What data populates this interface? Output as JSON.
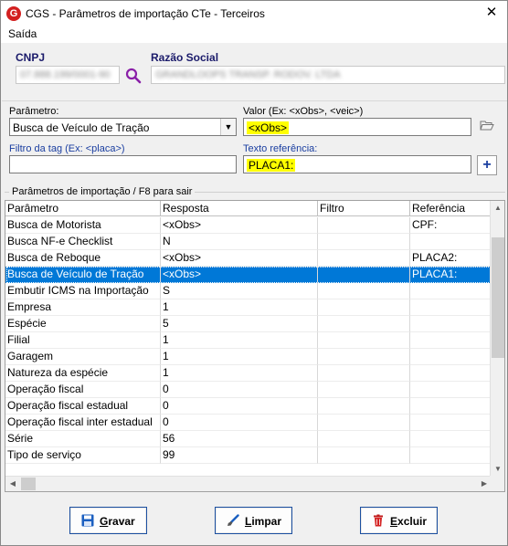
{
  "window": {
    "title": "CGS - Parâmetros de importação CTe - Terceiros",
    "close_glyph": "✕"
  },
  "menu": {
    "items": [
      "Saída"
    ]
  },
  "header": {
    "cnpj_label": "CNPJ",
    "cnpj_value": "07.888.199/0001-90",
    "razao_label": "Razão Social",
    "razao_value": "GRANDLOOPS TRANSP. RODOV. LTDA"
  },
  "form": {
    "parametro_label": "Parâmetro:",
    "parametro_value": "Busca de Veículo de Tração",
    "valor_label": "Valor (Ex: <xObs>, <veic>)",
    "valor_value": "<xObs>",
    "filtro_label": "Filtro da tag (Ex: <placa>)",
    "filtro_value": "",
    "texto_label": "Texto referência:",
    "texto_value": "PLACA1:",
    "plus_label": "+"
  },
  "grid": {
    "group_title": "Parâmetros de importação / F8 para sair",
    "columns": [
      "Parâmetro",
      "Resposta",
      "Filtro",
      "Referência"
    ],
    "rows": [
      [
        "Busca de Motorista",
        "<xObs>",
        "",
        "CPF:"
      ],
      [
        "Busca NF-e Checklist",
        "N",
        "",
        ""
      ],
      [
        "Busca de Reboque",
        "<xObs>",
        "",
        "PLACA2:"
      ],
      [
        "Busca de Veículo de Tração",
        "<xObs>",
        "",
        "PLACA1:"
      ],
      [
        "Embutir ICMS na Importação",
        "S",
        "",
        ""
      ],
      [
        "Empresa",
        "1",
        "",
        ""
      ],
      [
        "Espécie",
        "5",
        "",
        ""
      ],
      [
        "Filial",
        "1",
        "",
        ""
      ],
      [
        "Garagem",
        "1",
        "",
        ""
      ],
      [
        "Natureza da espécie",
        "1",
        "",
        ""
      ],
      [
        "Operação fiscal",
        "0",
        "",
        ""
      ],
      [
        "Operação fiscal estadual",
        "0",
        "",
        ""
      ],
      [
        "Operação fiscal inter estadual",
        "0",
        "",
        ""
      ],
      [
        "Série",
        "56",
        "",
        ""
      ],
      [
        "Tipo de serviço",
        "99",
        "",
        ""
      ]
    ],
    "selected_row": 3
  },
  "buttons": {
    "gravar_first": "G",
    "gravar_rest": "ravar",
    "limpar_first": "L",
    "limpar_rest": "impar",
    "excluir_first": "E",
    "excluir_rest": "xcluir"
  },
  "colors": {
    "accent": "#0078d7",
    "highlight": "#ffff00",
    "label_blue": "#1a3ea0",
    "button_border": "#1b4fa0"
  }
}
